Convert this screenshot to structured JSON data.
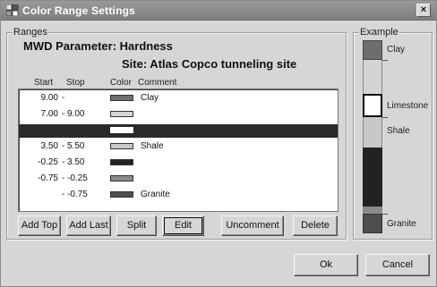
{
  "window": {
    "title": "Color Range Settings",
    "close_label": "×"
  },
  "ranges": {
    "group_caption": "Ranges",
    "mwd_parameter": "MWD Parameter:  Hardness",
    "site": "Site:  Atlas Copco tunneling site",
    "columns": {
      "start": "Start",
      "stop": "Stop",
      "color": "Color",
      "comment": "Comment"
    },
    "rows": [
      {
        "start": "9.00",
        "dash": "-",
        "stop": "",
        "color": "#6e6e6e",
        "comment": "Clay",
        "selected": false
      },
      {
        "start": "7.00",
        "dash": "-",
        "stop": "9.00",
        "color": "#d4d4d4",
        "comment": "",
        "selected": false
      },
      {
        "start": "",
        "dash": "",
        "stop": "",
        "color": "#ffffff",
        "comment": "",
        "selected": true
      },
      {
        "start": "3.50",
        "dash": "-",
        "stop": "5.50",
        "color": "#c8c8c8",
        "comment": "Shale",
        "selected": false
      },
      {
        "start": "-0.25",
        "dash": "-",
        "stop": "3.50",
        "color": "#222222",
        "comment": "",
        "selected": false
      },
      {
        "start": "-0.75",
        "dash": "-",
        "stop": "-0.25",
        "color": "#8a8a8a",
        "comment": "",
        "selected": false
      },
      {
        "start": "",
        "dash": "-",
        "stop": "-0.75",
        "color": "#4e4e4e",
        "comment": "Granite",
        "selected": false
      }
    ],
    "buttons": {
      "add_top": "Add Top",
      "add_last": "Add Last",
      "split": "Split",
      "edit": "Edit",
      "uncomment": "Uncomment",
      "delete": "Delete"
    }
  },
  "example": {
    "group_caption": "Example",
    "labels": {
      "clay": "Clay",
      "limestone": "Limestone",
      "shale": "Shale",
      "granite": "Granite"
    },
    "colors": {
      "clay": "#6e6e6e",
      "light": "#d4d4d4",
      "limestone": "#ffffff",
      "shale": "#c8c8c8",
      "dark": "#222222",
      "mid": "#8a8a8a",
      "granite": "#4e4e4e"
    }
  },
  "footer": {
    "ok": "Ok",
    "cancel": "Cancel"
  }
}
